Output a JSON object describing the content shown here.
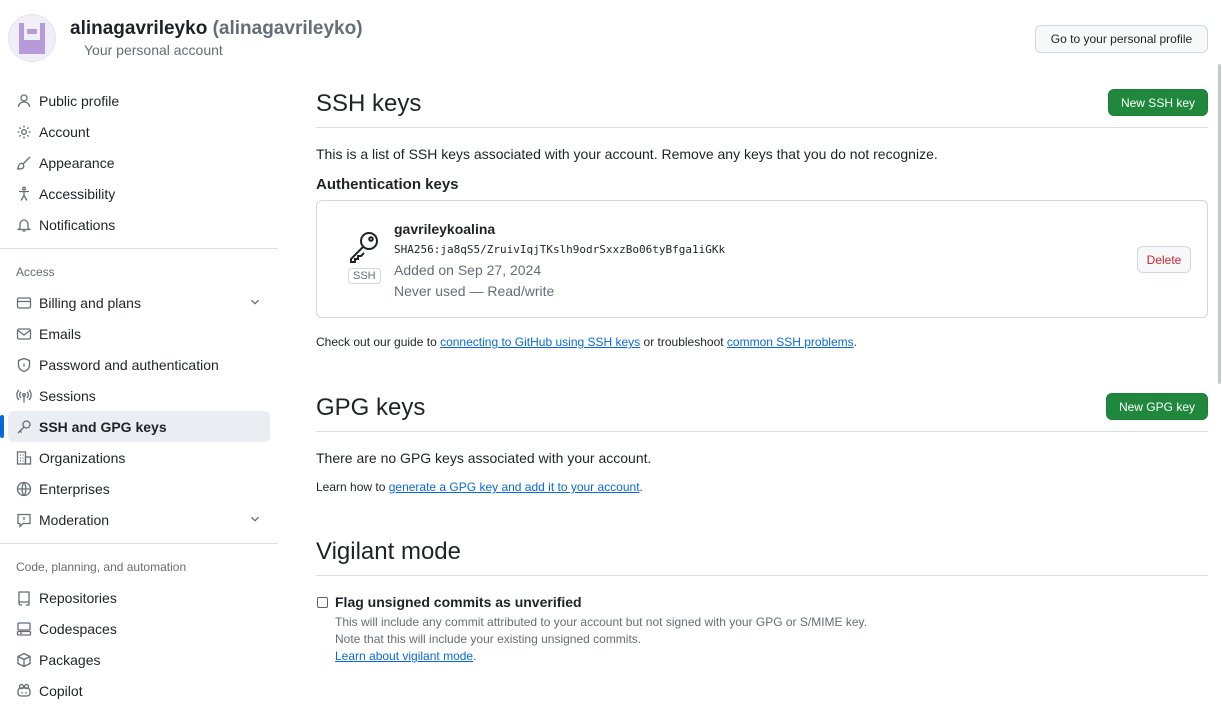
{
  "header": {
    "username": "alinagavrileyko",
    "login_display": "(alinagavrileyko)",
    "subtitle": "Your personal account",
    "profile_button": "Go to your personal profile"
  },
  "sidebar": {
    "items_top": [
      {
        "label": "Public profile",
        "icon": "person-icon"
      },
      {
        "label": "Account",
        "icon": "gear-icon"
      },
      {
        "label": "Appearance",
        "icon": "paintbrush-icon"
      },
      {
        "label": "Accessibility",
        "icon": "accessibility-icon"
      },
      {
        "label": "Notifications",
        "icon": "bell-icon"
      }
    ],
    "access_label": "Access",
    "items_access": [
      {
        "label": "Billing and plans",
        "icon": "credit-card-icon"
      },
      {
        "label": "Emails",
        "icon": "mail-icon"
      },
      {
        "label": "Password and authentication",
        "icon": "shield-lock-icon"
      },
      {
        "label": "Sessions",
        "icon": "broadcast-icon"
      },
      {
        "label": "SSH and GPG keys",
        "icon": "key-icon"
      },
      {
        "label": "Organizations",
        "icon": "organization-icon"
      },
      {
        "label": "Enterprises",
        "icon": "globe-icon"
      },
      {
        "label": "Moderation",
        "icon": "report-icon"
      }
    ],
    "code_label": "Code, planning, and automation",
    "items_code": [
      {
        "label": "Repositories",
        "icon": "repo-icon"
      },
      {
        "label": "Codespaces",
        "icon": "codespaces-icon"
      },
      {
        "label": "Packages",
        "icon": "package-icon"
      },
      {
        "label": "Copilot",
        "icon": "copilot-icon"
      }
    ]
  },
  "ssh": {
    "title": "SSH keys",
    "new_button": "New SSH key",
    "description": "This is a list of SSH keys associated with your account. Remove any keys that you do not recognize.",
    "auth_heading": "Authentication keys",
    "key": {
      "title": "gavrileykoalina",
      "fingerprint": "SHA256:ja8qS5/ZruivIqjTKslh9odrSxxzBo06tyBfga1iGKk",
      "added": "Added on Sep 27, 2024",
      "usage": "Never used — Read/write",
      "badge": "SSH",
      "delete_button": "Delete"
    },
    "guide_prefix": "Check out our guide to ",
    "guide_link1": "connecting to GitHub using SSH keys",
    "guide_middle": " or troubleshoot ",
    "guide_link2": "common SSH problems",
    "guide_suffix": "."
  },
  "gpg": {
    "title": "GPG keys",
    "new_button": "New GPG key",
    "empty": "There are no GPG keys associated with your account.",
    "learn_prefix": "Learn how to ",
    "learn_link": "generate a GPG key and add it to your account",
    "learn_suffix": "."
  },
  "vigilant": {
    "title": "Vigilant mode",
    "checkbox_label": "Flag unsigned commits as unverified",
    "line1": "This will include any commit attributed to your account but not signed with your GPG or S/MIME key.",
    "line2": "Note that this will include your existing unsigned commits.",
    "link": "Learn about vigilant mode",
    "link_suffix": "."
  },
  "colors": {
    "primary": "#1f883d",
    "link": "#0969da",
    "danger": "#cf222e",
    "selected_indicator": "#0969da"
  }
}
